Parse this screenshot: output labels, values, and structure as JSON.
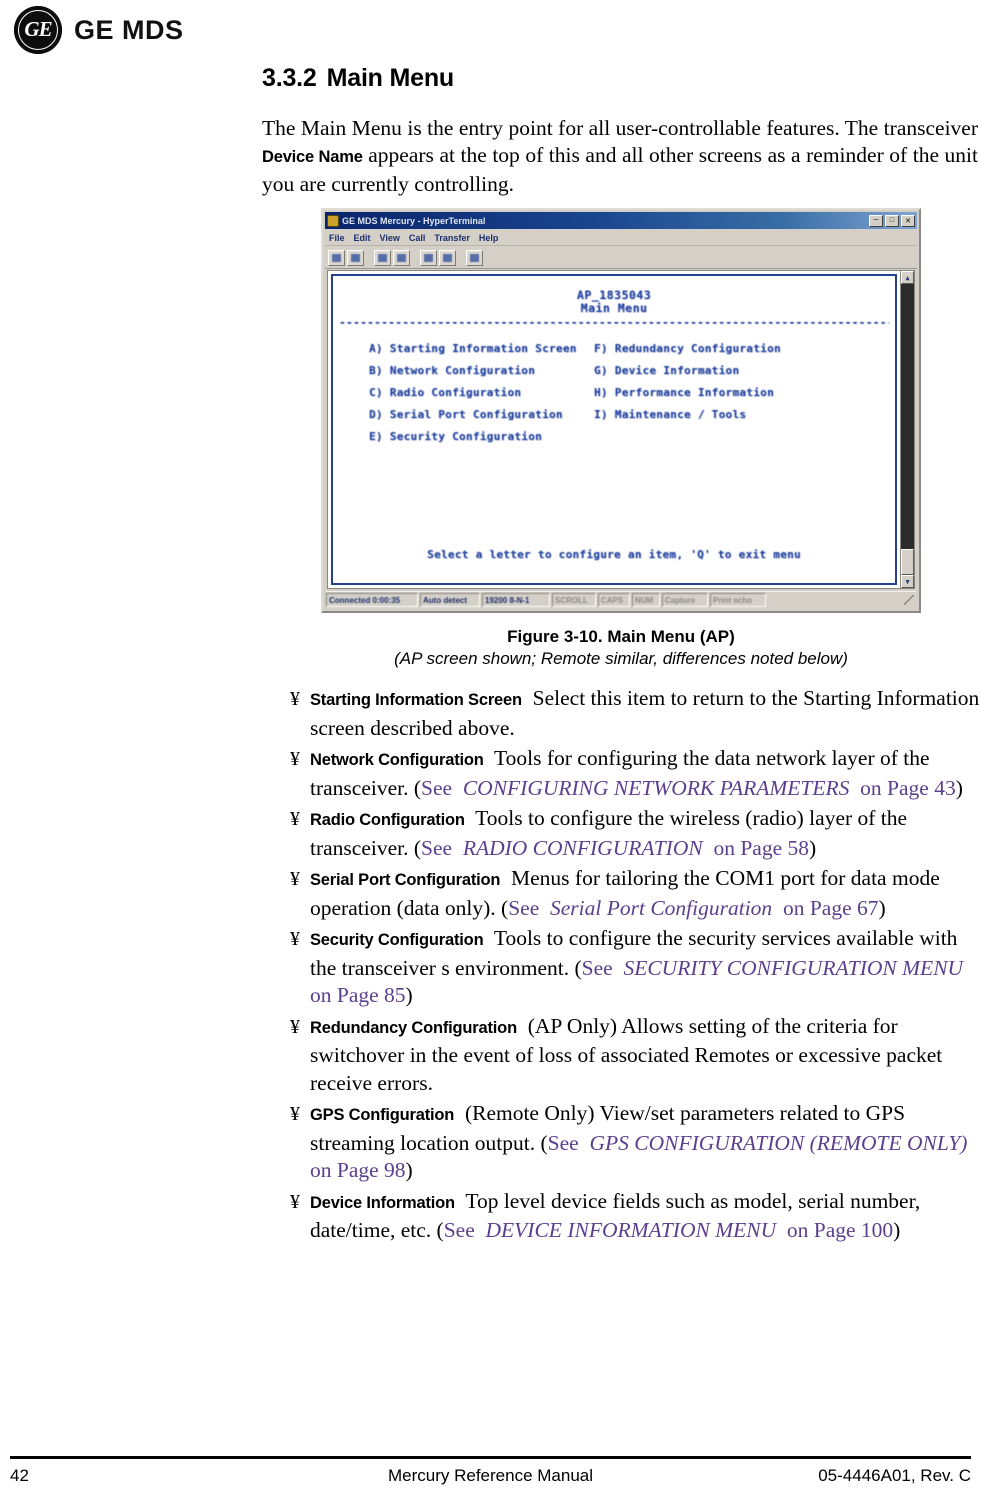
{
  "brand": {
    "monogram_letters": "GE",
    "wordmark": "GE MDS"
  },
  "heading": {
    "number": "3.3.2",
    "title": "Main Menu"
  },
  "intro": {
    "part1": "The Main Menu is the entry point for all user-controllable features. The transceiver",
    "ui_term": "Device Name",
    "part2": "appears at the top of this and all other screens as a reminder of the unit you are currently controlling."
  },
  "terminal": {
    "title_bar": "GE MDS Mercury - HyperTerminal",
    "menus": [
      "File",
      "Edit",
      "View",
      "Call",
      "Transfer",
      "Help"
    ],
    "toolbar_icons": [
      "new-connection-icon",
      "open-icon",
      "call-icon",
      "disconnect-icon",
      "send-file-icon",
      "receive-file-icon",
      "properties-icon"
    ],
    "screen": {
      "device_name": "AP_1835043",
      "screen_title": "Main Menu",
      "divider": "-------------------------------------------------------------------------------",
      "menu_left": [
        "A) Starting Information Screen",
        "B) Network Configuration",
        "C) Radio Configuration",
        "D) Serial Port Configuration",
        "E) Security Configuration"
      ],
      "menu_right": [
        "F) Redundancy Configuration",
        "G) Device Information",
        "H) Performance Information",
        "I) Maintenance / Tools"
      ],
      "prompt": "Select a letter to configure an item, 'Q' to exit menu"
    },
    "status_bar": [
      {
        "label": "Connected 0:00:35",
        "dim": false
      },
      {
        "label": "Auto detect",
        "dim": false
      },
      {
        "label": "19200 8-N-1",
        "dim": false
      },
      {
        "label": "SCROLL",
        "dim": true
      },
      {
        "label": "CAPS",
        "dim": true
      },
      {
        "label": "NUM",
        "dim": true
      },
      {
        "label": "Capture",
        "dim": true
      },
      {
        "label": "Print echo",
        "dim": true
      }
    ],
    "window_buttons": [
      "minimize",
      "maximize",
      "close"
    ]
  },
  "figure": {
    "caption_line1": "Figure 3-10. Main Menu (AP)",
    "caption_line2": "(AP screen shown; Remote similar, differences noted below)"
  },
  "bullet_glyph": "¥",
  "features": [
    {
      "label": "Starting Information Screen",
      "text_before": "Select this item to return to the Starting Information screen described above.",
      "see": "",
      "xref": "",
      "page_text": "",
      "text_after": ""
    },
    {
      "label": "Network Configuration",
      "text_before": "Tools for configuring the data network layer of the transceiver. (",
      "see": "See",
      "xref": "CONFIGURING NETWORK PARAMETERS",
      "page_text": "on Page 43",
      "text_after": ")"
    },
    {
      "label": "Radio Configuration",
      "text_before": "Tools to configure the wireless (radio) layer of the transceiver. (",
      "see": "See",
      "xref": "RADIO CONFIGURATION",
      "page_text": "on Page 58",
      "text_after": ")"
    },
    {
      "label": "Serial Port Configuration",
      "text_before": "Menus for tailoring the  COM1 port for data mode operation (data only). (",
      "see": "See",
      "xref": "Serial Port Configuration",
      "page_text": "on Page 67",
      "text_after": ")"
    },
    {
      "label": "Security Configuration",
      "text_before": "Tools to configure the security services available with the transceiver  s environment. (",
      "see": "See",
      "xref": "SECURITY CONFIGURATION MENU",
      "page_text": "on Page 85",
      "text_after": ")"
    },
    {
      "label": "Redundancy Configuration",
      "text_before": "(AP Only) Allows setting of the criteria for switchover in the event of loss of associated Remotes or excessive packet receive errors.",
      "see": "",
      "xref": "",
      "page_text": "",
      "text_after": ""
    },
    {
      "label": "GPS Configuration",
      "text_before": "(Remote Only) View/set parameters related to GPS streaming location output. (",
      "see": "See",
      "xref": "GPS CONFIGURATION (REMOTE ONLY)",
      "page_text": "on Page 98",
      "text_after": ")"
    },
    {
      "label": "Device Information",
      "text_before": "Top level device fields such as model, serial number, date/time, etc. (",
      "see": "See",
      "xref": "DEVICE INFORMATION MENU",
      "page_text": "on Page 100",
      "text_after": ")"
    }
  ],
  "footer": {
    "page_number": "42",
    "manual_title": "Mercury Reference Manual",
    "doc_number": "05-4446A01, Rev. C"
  }
}
